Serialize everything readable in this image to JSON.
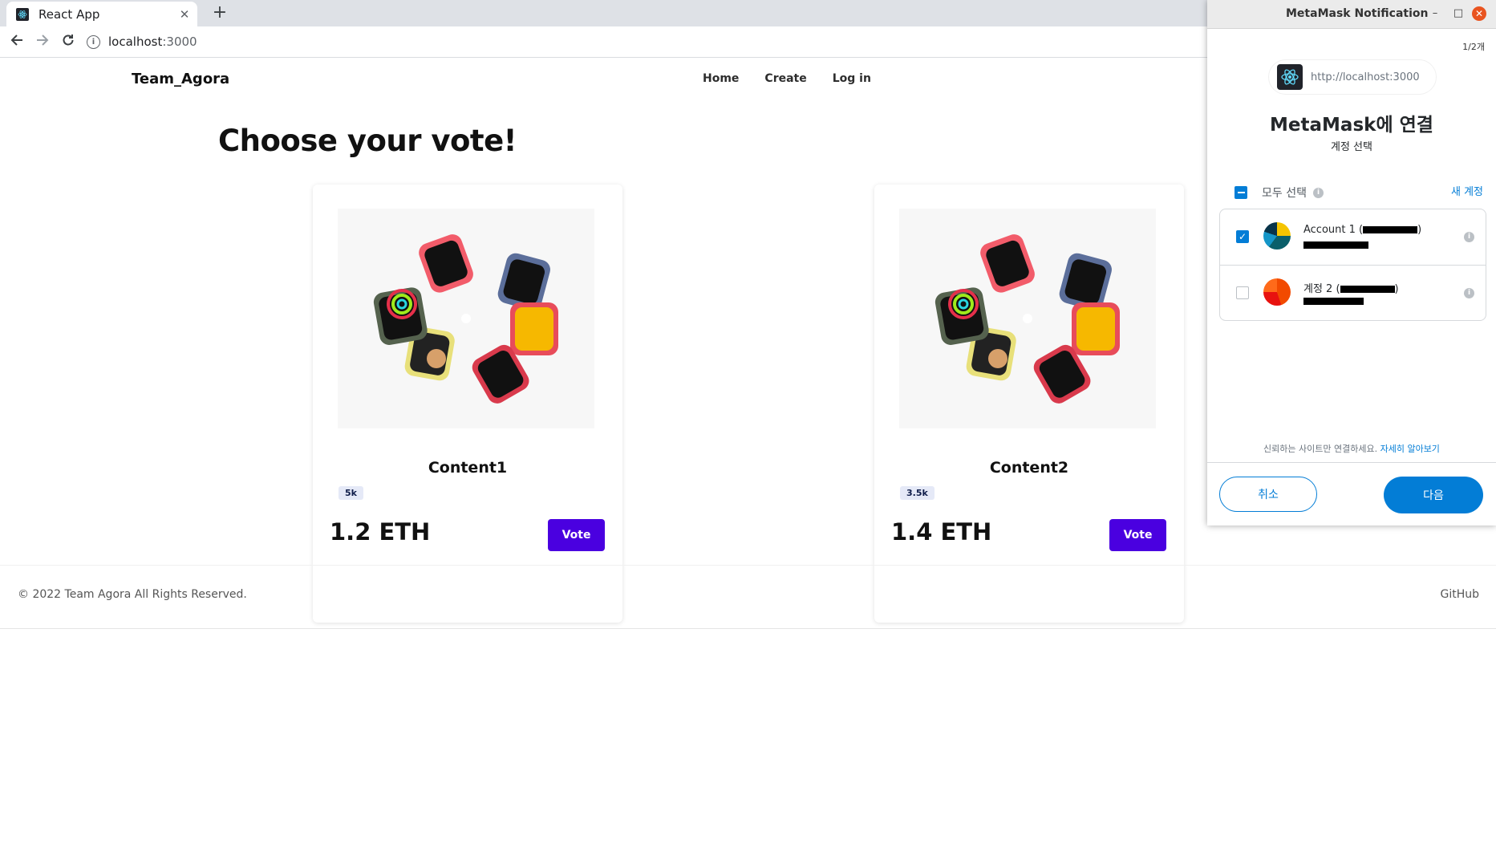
{
  "browser": {
    "tab_title": "React App",
    "tab_close": "✕",
    "new_tab": "+",
    "url_host": "localhost",
    "url_port": ":3000"
  },
  "site": {
    "brand": "Team_Agora",
    "nav": [
      "Home",
      "Create",
      "Log in"
    ],
    "headline": "Choose your vote!",
    "cards": [
      {
        "title": "Content1",
        "badge": "5k",
        "price": "1.2 ETH",
        "button": "Vote"
      },
      {
        "title": "Content2",
        "badge": "3.5k",
        "price": "1.4 ETH",
        "button": "Vote"
      }
    ],
    "footer": {
      "copyright": "© 2022 Team Agora All Rights Reserved.",
      "github": "GitHub"
    }
  },
  "metamask": {
    "window_title": "MetaMask Notification",
    "counter": "1/2개",
    "origin": "http://localhost:3000",
    "heading": "MetaMask에 연결",
    "subheading": "계정 선택",
    "select_all": "모두 선택",
    "new_account": "새 계정",
    "accounts": [
      {
        "name": "Account 1 (",
        "suffix": ")",
        "checked": true
      },
      {
        "name": "계정 2 (",
        "suffix": ")",
        "checked": false
      }
    ],
    "trust_text": "신뢰하는 사이트만 연결하세요. ",
    "learn_more": "자세히 알아보기",
    "cancel": "취소",
    "next": "다음"
  },
  "colors": {
    "vote_button": "#4a00e0",
    "metamask_blue": "#037dd6",
    "badge_bg": "#e5e9f7"
  }
}
